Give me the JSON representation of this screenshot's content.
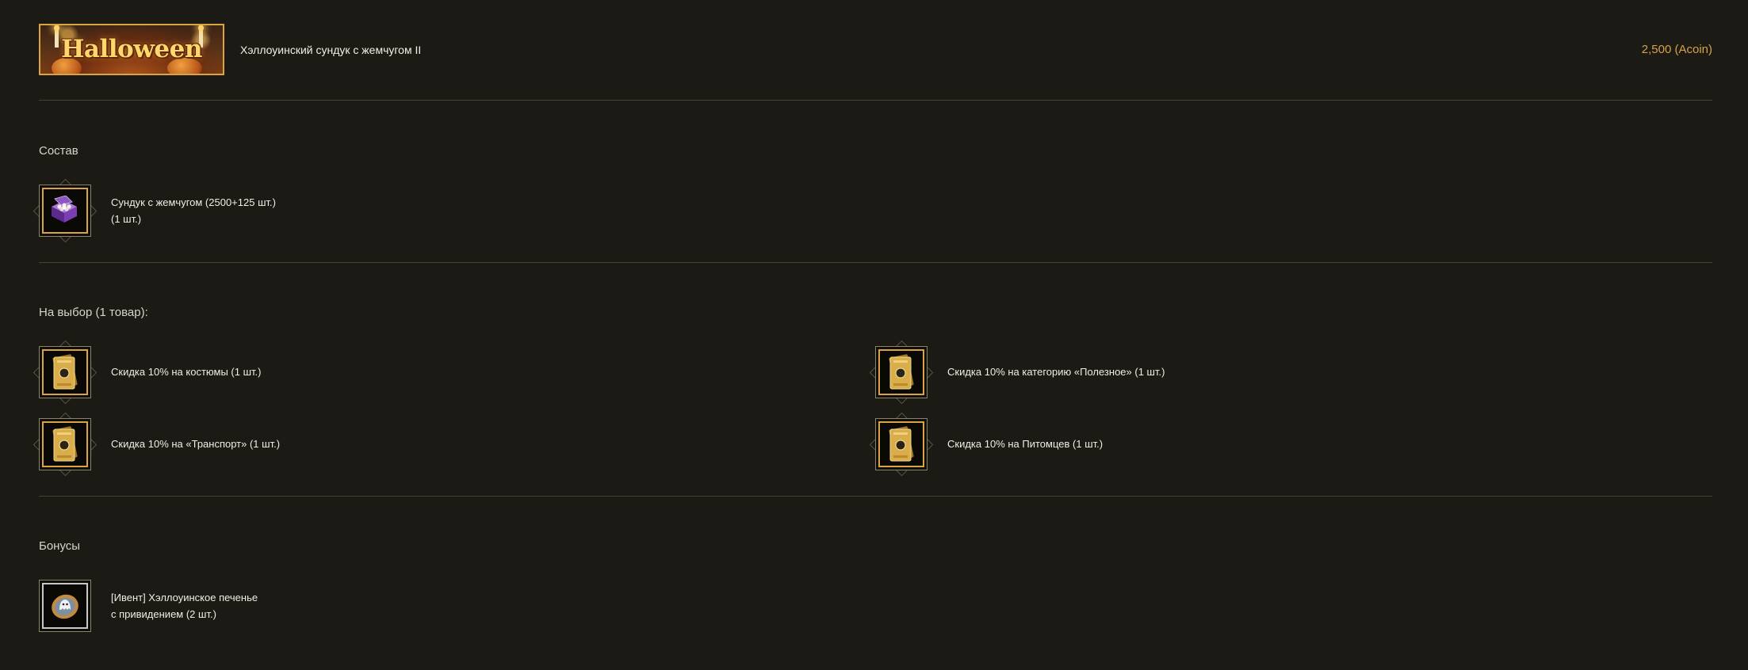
{
  "header": {
    "banner_text": "Halloween",
    "product_name": "Хэллоуинский сундук с жемчугом II",
    "price": "2,500 (Acoin)"
  },
  "composition": {
    "title": "Состав",
    "item": {
      "icon": "pearl-chest-icon",
      "line1": "Сундук с жемчугом (2500+125 шт.)",
      "line2": "(1 шт.)"
    }
  },
  "choice": {
    "title": "На выбор (1 товар):",
    "items": [
      {
        "icon": "discount-ticket-icon",
        "label": "Скидка 10% на костюмы (1 шт.)"
      },
      {
        "icon": "discount-ticket-icon",
        "label": "Скидка 10% на категорию «Полезное» (1 шт.)"
      },
      {
        "icon": "discount-ticket-icon",
        "label": "Скидка 10% на «Транспорт» (1 шт.)"
      },
      {
        "icon": "discount-ticket-icon",
        "label": "Скидка 10% на Питомцев (1 шт.)"
      }
    ]
  },
  "bonuses": {
    "title": "Бонусы",
    "item": {
      "icon": "ghost-cookie-icon",
      "line1": "[Ивент] Хэллоуинское печенье",
      "line2": "с привидением (2 шт.)"
    }
  },
  "colors": {
    "background": "#1b1a14",
    "accent_gold": "#d9a441",
    "price": "#d7a24a"
  }
}
